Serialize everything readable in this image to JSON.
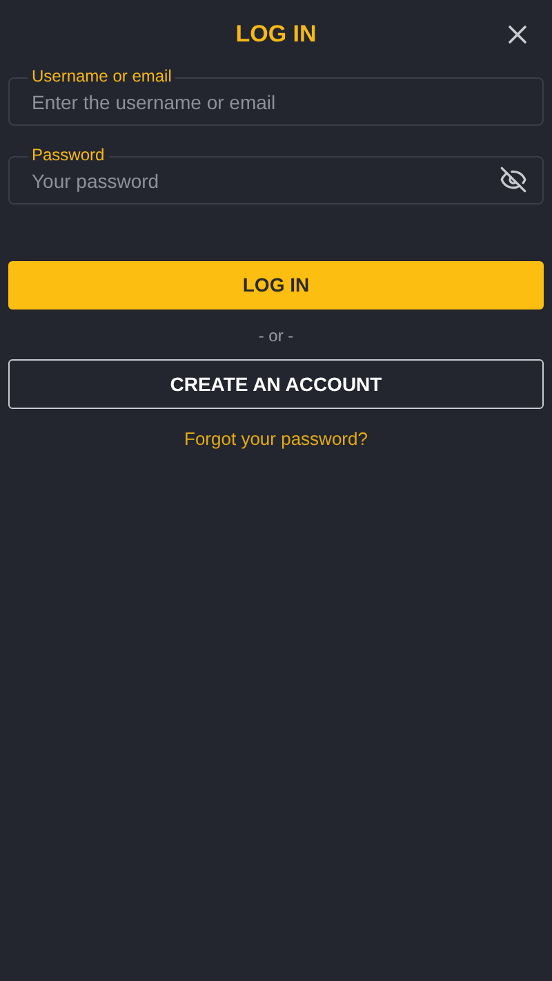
{
  "title": "LOG IN",
  "fields": [
    {
      "kind": "text",
      "label": "Username or email",
      "placeholder": "Enter the username or email"
    },
    {
      "kind": "password",
      "label": "Password",
      "placeholder": "Your password"
    }
  ],
  "login_button": "LOG IN",
  "separator": "- or -",
  "create_button": "CREATE AN ACCOUNT",
  "forgot_link": "Forgot your password?"
}
